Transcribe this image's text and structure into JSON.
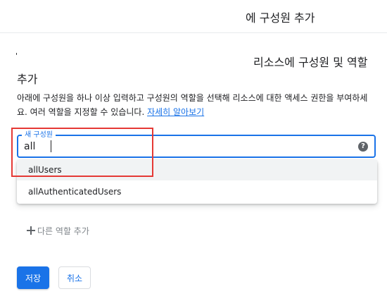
{
  "header": {
    "title": "에 구성원 추가"
  },
  "artifact_char": "'",
  "section": {
    "title_right": "리소스에 구성원 및 역할",
    "title_left": "추가",
    "description": "아래에 구성원을 하나 이상 입력하고 구성원의 역할을 선택해 리소스에 대한 액세스 권한을 부여하세요. 여러 역할을 지정할 수 있습니다. ",
    "learn_more": "자세히 알아보기"
  },
  "member_input": {
    "label": "새 구성원",
    "value": "all",
    "help_icon": "help-circle-icon"
  },
  "suggestions": [
    "allUsers",
    "allAuthenticatedUsers"
  ],
  "add_role": {
    "label": "다른 역할 추가",
    "icon": "plus-icon"
  },
  "actions": {
    "save": "저장",
    "cancel": "취소"
  },
  "colors": {
    "accent": "#1a73e8",
    "highlight_box": "#e53935"
  }
}
